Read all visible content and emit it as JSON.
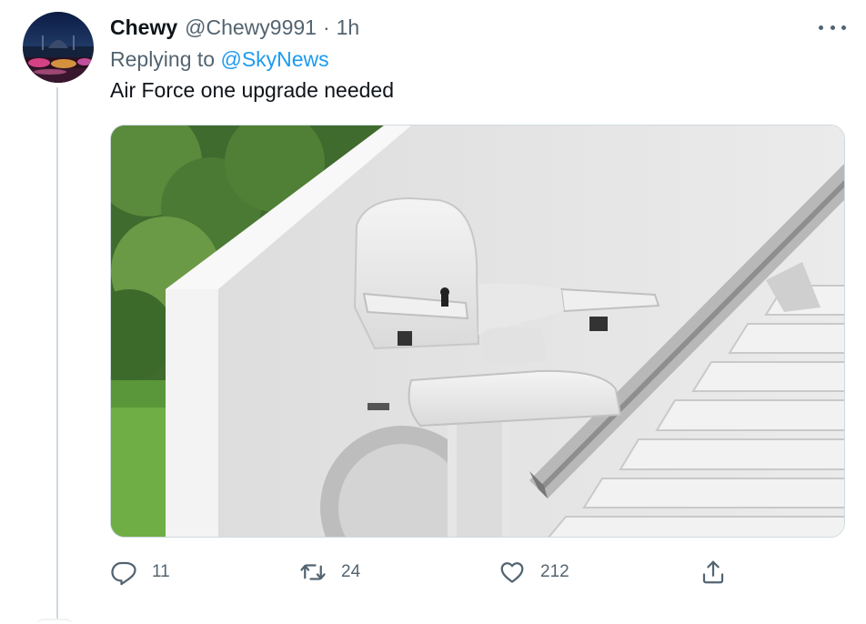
{
  "author": {
    "name": "Chewy",
    "handle": "@Chewy9991",
    "separator": "·",
    "time": "1h"
  },
  "reply": {
    "prefix": "Replying to",
    "mention": "@SkyNews"
  },
  "tweet": {
    "text": "Air Force one upgrade needed"
  },
  "actions": {
    "reply_count": "11",
    "retweet_count": "24",
    "like_count": "212"
  },
  "icons": {
    "more": "more-horizontal-icon",
    "reply": "speech-bubble-icon",
    "retweet": "retweet-arrows-icon",
    "like": "heart-icon",
    "share": "share-upload-icon"
  },
  "colors": {
    "text": "#0f1419",
    "secondary": "#536471",
    "link": "#1d9bf0",
    "border": "#cfd9de"
  }
}
